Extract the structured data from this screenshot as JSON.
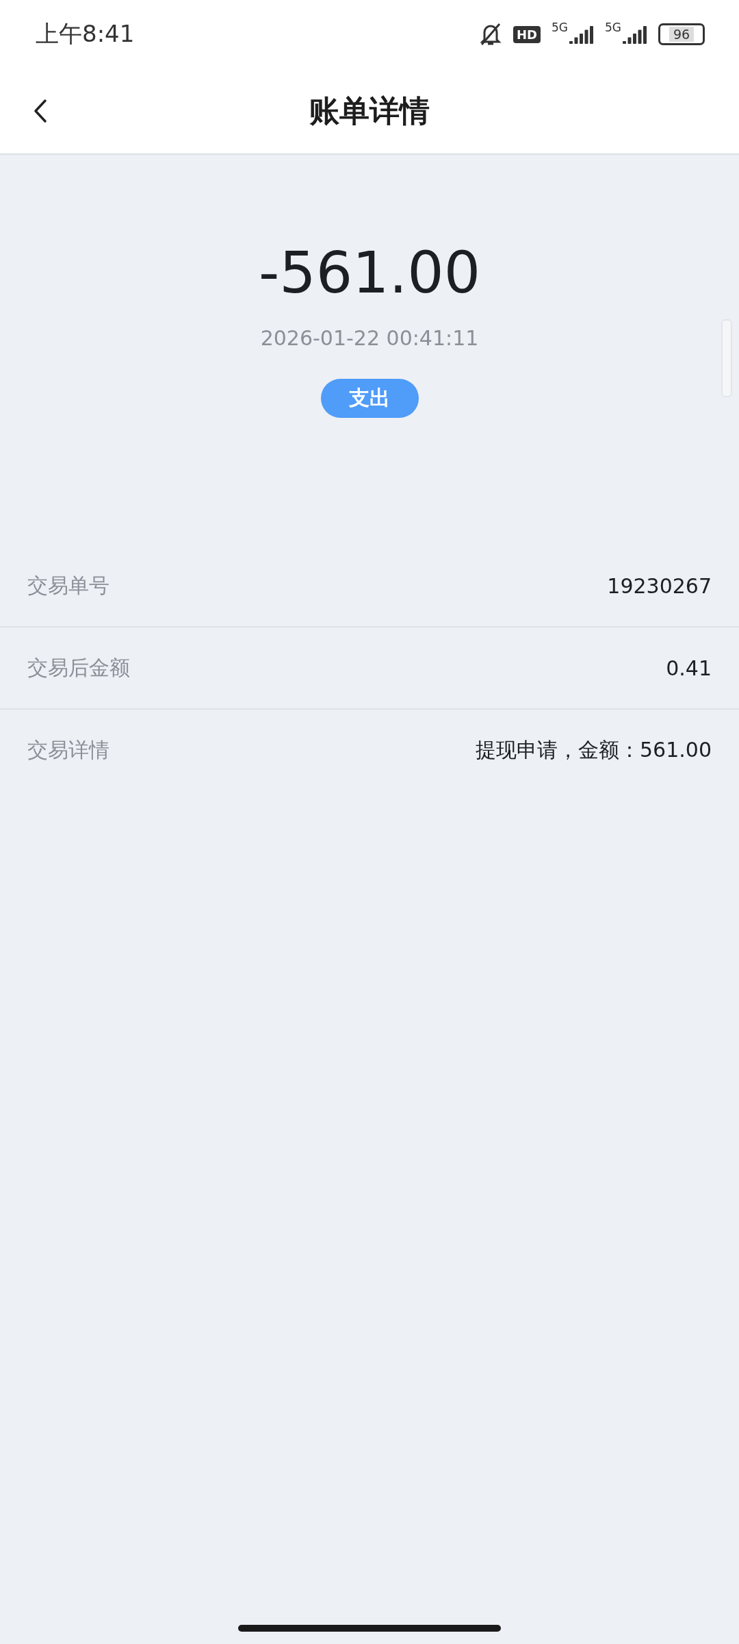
{
  "status_bar": {
    "time": "上午8:41",
    "hd_badge": "HD",
    "signals": [
      {
        "label": "5G"
      },
      {
        "label": "5G"
      }
    ],
    "battery": "96"
  },
  "header": {
    "title": "账单详情"
  },
  "summary": {
    "amount": "-561.00",
    "datetime": "2026-01-22 00:41:11",
    "type_badge": "支出"
  },
  "details": [
    {
      "label": "交易单号",
      "value": "19230267"
    },
    {
      "label": "交易后金额",
      "value": "0.41"
    },
    {
      "label": "交易详情",
      "value": "提现申请，金额：561.00"
    }
  ]
}
